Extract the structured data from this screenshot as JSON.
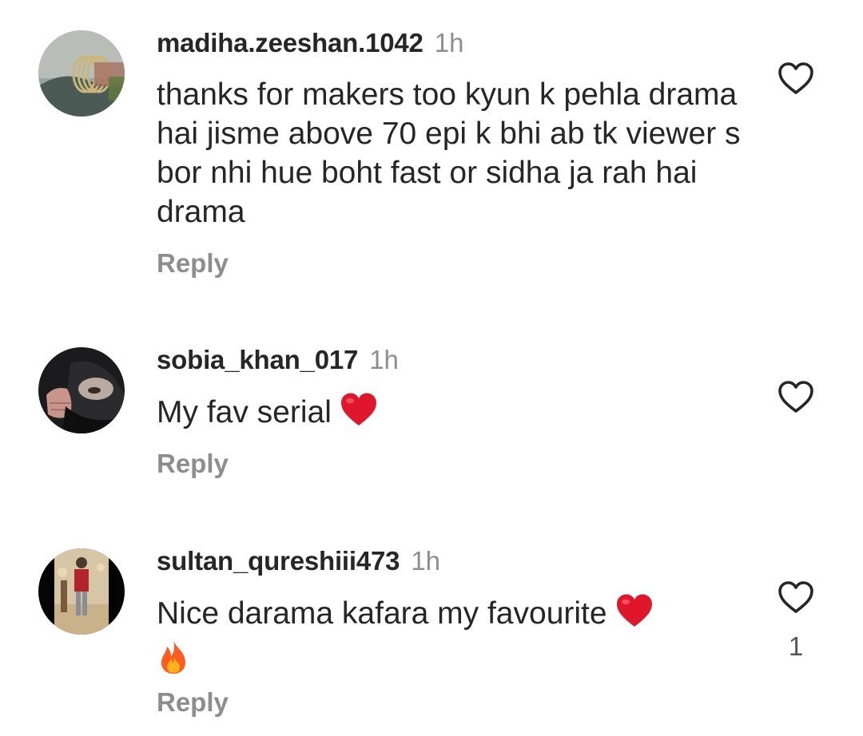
{
  "comments": [
    {
      "username": "madiha.zeeshan.1042",
      "time": "1h",
      "text": "thanks for makers too kyun k pehla drama hai jisme above 70 epi k bhi ab tk viewer s bor nhi hue boht fast or sidha ja rah hai drama",
      "reply_label": "Reply",
      "like_icon": "heart-outline-icon"
    },
    {
      "username": "sobia_khan_017",
      "time": "1h",
      "text": "My fav serial",
      "emoji": "red-heart",
      "reply_label": "Reply",
      "like_icon": "heart-outline-icon"
    },
    {
      "username": "sultan_qureshiii473",
      "time": "1h",
      "text": "Nice darama kafara my favourite",
      "emoji": "red-heart, fire",
      "reply_label": "Reply",
      "like_icon": "heart-outline-icon",
      "like_count": "1"
    }
  ],
  "colors": {
    "text": "#262626",
    "muted": "#8e8e8e",
    "heart_emoji": "#e0162b"
  }
}
